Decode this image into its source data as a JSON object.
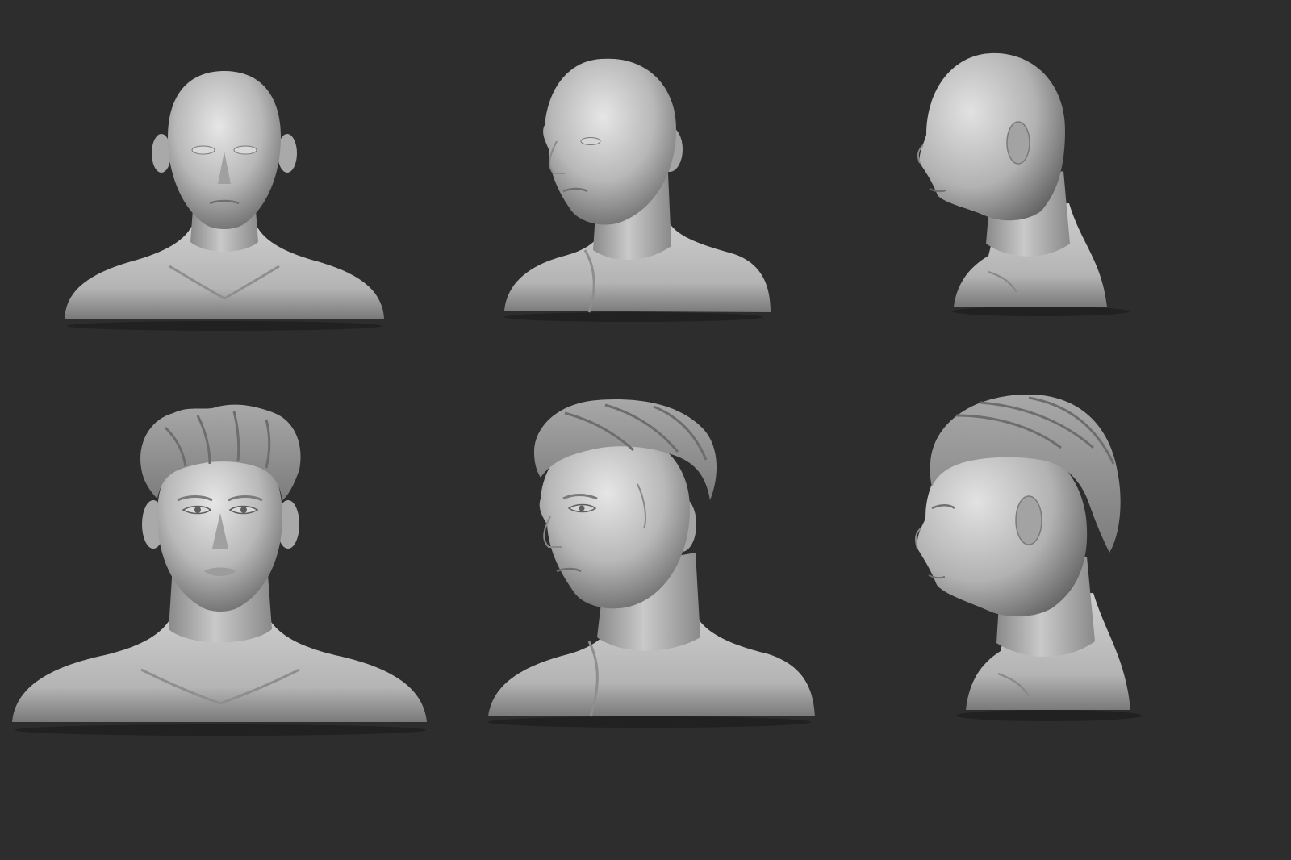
{
  "scene": {
    "background_color": "#2d2d2d",
    "material_color": "#b9b9b9",
    "highlight_color": "#e2e2e2",
    "shadow_color": "#555555",
    "hair_color": "#9a9a9a",
    "rows": [
      {
        "name": "bald-sculpt-row",
        "busts": [
          {
            "view": "front",
            "hair": false
          },
          {
            "view": "three-quarter",
            "hair": false
          },
          {
            "view": "profile",
            "hair": false
          }
        ]
      },
      {
        "name": "hair-sculpt-row",
        "busts": [
          {
            "view": "front",
            "hair": true
          },
          {
            "view": "three-quarter",
            "hair": true
          },
          {
            "view": "profile",
            "hair": true
          }
        ]
      }
    ]
  }
}
